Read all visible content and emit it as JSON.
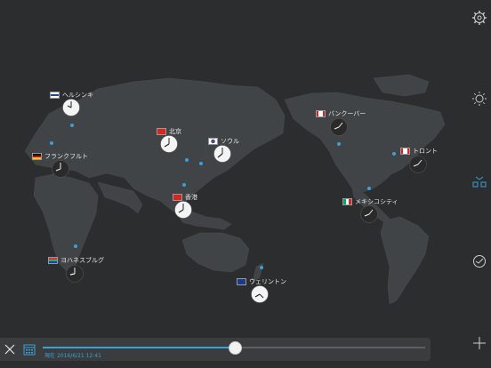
{
  "cities": [
    {
      "name": "ヘルシンキ",
      "flag": "fi",
      "clock": "light"
    },
    {
      "name": "フランクフルト",
      "flag": "de",
      "clock": "dark"
    },
    {
      "name": "北京",
      "flag": "cn",
      "clock": "light"
    },
    {
      "name": "ソウル",
      "flag": "kr",
      "clock": "light"
    },
    {
      "name": "香港",
      "flag": "hk",
      "clock": "light"
    },
    {
      "name": "ヨハネスブルグ",
      "flag": "za",
      "clock": "dark"
    },
    {
      "name": "ウェリントン",
      "flag": "nz",
      "clock": "light"
    },
    {
      "name": "バンクーバー",
      "flag": "ca",
      "clock": "dark"
    },
    {
      "name": "トロント",
      "flag": "ca",
      "clock": "dark"
    },
    {
      "name": "メキシコシティ",
      "flag": "mx",
      "clock": "dark"
    }
  ],
  "bottom": {
    "time_label": "現在",
    "time_value": "2016/6/21 12:41",
    "slider_fraction": 0.5
  },
  "side_icons": [
    "gear-icon",
    "brightness-icon",
    "grid-clock-icon",
    "world-clock-icon"
  ],
  "colors": {
    "accent": "#3aa0d8",
    "background": "#2b2d2e",
    "land": "#414446"
  }
}
